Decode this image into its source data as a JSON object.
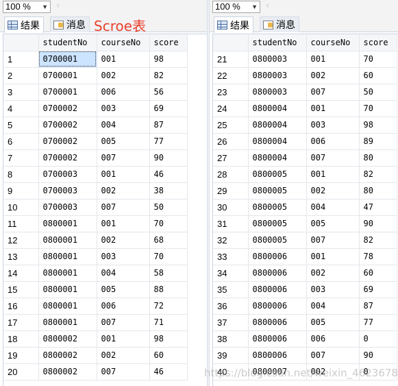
{
  "annotation": "Scroe表",
  "watermark": "https://blog.csdn.net/weixin_46236781",
  "left": {
    "zoom": "100 %",
    "tabs": [
      {
        "label": "结果"
      },
      {
        "label": "消息"
      }
    ],
    "columns": [
      "studentNo",
      "courseNo",
      "score"
    ],
    "rows": [
      {
        "n": "1",
        "studentNo": "0700001",
        "courseNo": "001",
        "score": "98"
      },
      {
        "n": "2",
        "studentNo": "0700001",
        "courseNo": "002",
        "score": "82"
      },
      {
        "n": "3",
        "studentNo": "0700001",
        "courseNo": "006",
        "score": "56"
      },
      {
        "n": "4",
        "studentNo": "0700002",
        "courseNo": "003",
        "score": "69"
      },
      {
        "n": "5",
        "studentNo": "0700002",
        "courseNo": "004",
        "score": "87"
      },
      {
        "n": "6",
        "studentNo": "0700002",
        "courseNo": "005",
        "score": "77"
      },
      {
        "n": "7",
        "studentNo": "0700002",
        "courseNo": "007",
        "score": "90"
      },
      {
        "n": "8",
        "studentNo": "0700003",
        "courseNo": "001",
        "score": "46"
      },
      {
        "n": "9",
        "studentNo": "0700003",
        "courseNo": "002",
        "score": "38"
      },
      {
        "n": "10",
        "studentNo": "0700003",
        "courseNo": "007",
        "score": "50"
      },
      {
        "n": "11",
        "studentNo": "0800001",
        "courseNo": "001",
        "score": "70"
      },
      {
        "n": "12",
        "studentNo": "0800001",
        "courseNo": "002",
        "score": "68"
      },
      {
        "n": "13",
        "studentNo": "0800001",
        "courseNo": "003",
        "score": "70"
      },
      {
        "n": "14",
        "studentNo": "0800001",
        "courseNo": "004",
        "score": "58"
      },
      {
        "n": "15",
        "studentNo": "0800001",
        "courseNo": "005",
        "score": "88"
      },
      {
        "n": "16",
        "studentNo": "0800001",
        "courseNo": "006",
        "score": "72"
      },
      {
        "n": "17",
        "studentNo": "0800001",
        "courseNo": "007",
        "score": "71"
      },
      {
        "n": "18",
        "studentNo": "0800002",
        "courseNo": "001",
        "score": "98"
      },
      {
        "n": "19",
        "studentNo": "0800002",
        "courseNo": "002",
        "score": "60"
      },
      {
        "n": "20",
        "studentNo": "0800002",
        "courseNo": "007",
        "score": "46"
      }
    ]
  },
  "right": {
    "zoom": "100 %",
    "tabs": [
      {
        "label": "结果"
      },
      {
        "label": "消息"
      }
    ],
    "columns": [
      "studentNo",
      "courseNo",
      "score"
    ],
    "rows": [
      {
        "n": "21",
        "studentNo": "0800003",
        "courseNo": "001",
        "score": "70"
      },
      {
        "n": "22",
        "studentNo": "0800003",
        "courseNo": "002",
        "score": "60"
      },
      {
        "n": "23",
        "studentNo": "0800003",
        "courseNo": "007",
        "score": "50"
      },
      {
        "n": "24",
        "studentNo": "0800004",
        "courseNo": "001",
        "score": "70"
      },
      {
        "n": "25",
        "studentNo": "0800004",
        "courseNo": "003",
        "score": "98"
      },
      {
        "n": "26",
        "studentNo": "0800004",
        "courseNo": "006",
        "score": "89"
      },
      {
        "n": "27",
        "studentNo": "0800004",
        "courseNo": "007",
        "score": "80"
      },
      {
        "n": "28",
        "studentNo": "0800005",
        "courseNo": "001",
        "score": "82"
      },
      {
        "n": "29",
        "studentNo": "0800005",
        "courseNo": "002",
        "score": "80"
      },
      {
        "n": "30",
        "studentNo": "0800005",
        "courseNo": "004",
        "score": "47"
      },
      {
        "n": "31",
        "studentNo": "0800005",
        "courseNo": "005",
        "score": "90"
      },
      {
        "n": "32",
        "studentNo": "0800005",
        "courseNo": "007",
        "score": "82"
      },
      {
        "n": "33",
        "studentNo": "0800006",
        "courseNo": "001",
        "score": "78"
      },
      {
        "n": "34",
        "studentNo": "0800006",
        "courseNo": "002",
        "score": "60"
      },
      {
        "n": "35",
        "studentNo": "0800006",
        "courseNo": "003",
        "score": "69"
      },
      {
        "n": "36",
        "studentNo": "0800006",
        "courseNo": "004",
        "score": "87"
      },
      {
        "n": "37",
        "studentNo": "0800006",
        "courseNo": "005",
        "score": "77"
      },
      {
        "n": "38",
        "studentNo": "0800006",
        "courseNo": "006",
        "score": "0"
      },
      {
        "n": "39",
        "studentNo": "0800006",
        "courseNo": "007",
        "score": "90"
      },
      {
        "n": "40",
        "studentNo": "0800007",
        "courseNo": "002",
        "score": "0"
      }
    ]
  }
}
